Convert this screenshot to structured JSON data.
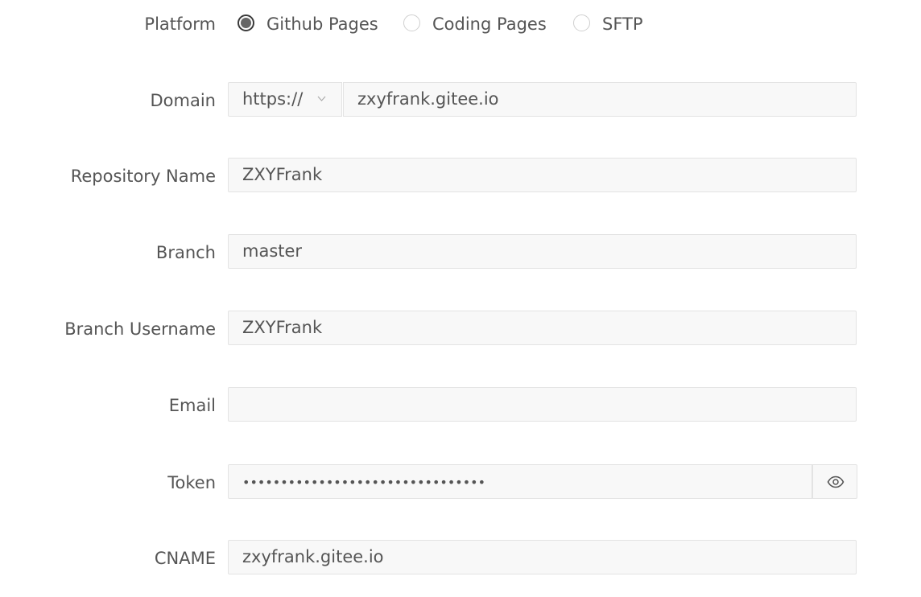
{
  "platform": {
    "label": "Platform",
    "options": [
      {
        "label": "Github Pages",
        "checked": true
      },
      {
        "label": "Coding Pages",
        "checked": false
      },
      {
        "label": "SFTP",
        "checked": false
      }
    ]
  },
  "domain": {
    "label": "Domain",
    "protocol": "https://",
    "protocol_icon": "chevron-down-icon",
    "value": "zxyfrank.gitee.io"
  },
  "repository": {
    "label": "Repository Name",
    "value": "ZXYFrank"
  },
  "branch": {
    "label": "Branch",
    "value": "master"
  },
  "branch_username": {
    "label": "Branch Username",
    "value": "ZXYFrank"
  },
  "email": {
    "label": "Email",
    "value": ""
  },
  "token": {
    "label": "Token",
    "value": "••••••••••••••••••••••••••••••••",
    "toggle_icon": "eye-icon"
  },
  "cname": {
    "label": "CNAME",
    "value": "zxyfrank.gitee.io"
  }
}
